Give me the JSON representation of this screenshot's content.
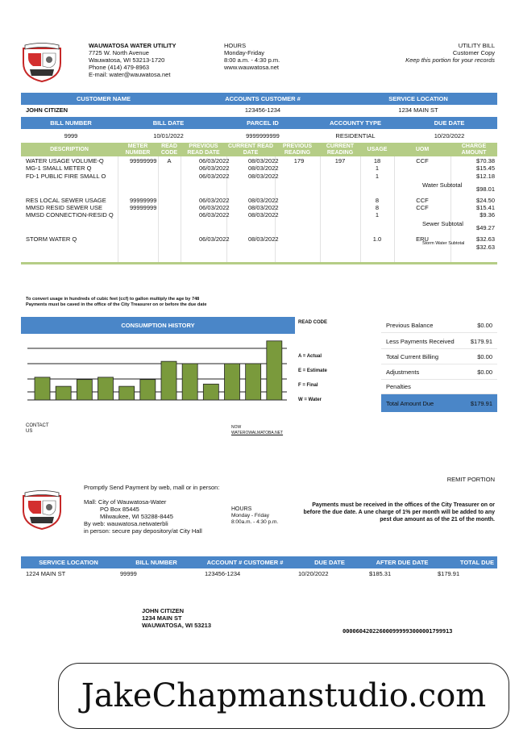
{
  "utility": {
    "name": "WAUWATOSA WATER UTILITY",
    "address1": "7725 W. North Avenue",
    "address2": "Wauwatosa, WI 53213-1720",
    "phone": "Phone (414) 479-8963",
    "email": "E-mail: water@wauwatosa.net",
    "logo_text": "WAUWATOSA",
    "logo_motto": "IN GOD WE TRUST"
  },
  "hours": {
    "label": "HOURS",
    "days": "Monday-Friday",
    "time": "8:00 a.m. - 4:30 p.m.",
    "web": "www.wauwatosa.net"
  },
  "bill_type": {
    "title": "UTILITY BILL",
    "copy": "Customer Copy",
    "keep": "Keep this portion for your records"
  },
  "customer_bar": {
    "h1": "CUSTOMER NAME",
    "h2": "ACCOUNTS CUSTOMER #",
    "h3": "SERVICE LOCATION",
    "name": "JOHN CITIZEN",
    "account": "123456-1234",
    "location": "1234 MAIN ST"
  },
  "bill_bar": {
    "h1": "BILL NUMBER",
    "h2": "BILL DATE",
    "h3": "PARCEL ID",
    "h4": "ACCOUNTY TYPE",
    "h5": "DUE DATE",
    "bill_number": "9999",
    "bill_date": "10/01/2022",
    "parcel_id": "9999999999",
    "account_type": "RESIDENTIAL",
    "due_date": "10/20/2022"
  },
  "charges": {
    "headers": [
      "DESCRIPTION",
      "METER NUMBER",
      "READ CODE",
      "PREVIOUS READ DATE",
      "CURRENT READ DATE",
      "PREVIOUS READING",
      "CURRENT READING",
      "USAGE",
      "UOM",
      "CHARGE AMOUNT"
    ],
    "rows": [
      {
        "desc": "WATER USAGE VOLUME-Q",
        "meter": "99999999",
        "code": "A",
        "prev_date": "06/03/2022",
        "cur_date": "08/03/2022",
        "prev_read": "179",
        "cur_read": "197",
        "usage": "18",
        "uom": "CCF",
        "amount": "$70.38"
      },
      {
        "desc": "MG-1 SMALL METER Q",
        "meter": "",
        "code": "",
        "prev_date": "06/03/2022",
        "cur_date": "08/03/2022",
        "prev_read": "",
        "cur_read": "",
        "usage": "1",
        "uom": "",
        "amount": "$15.45"
      },
      {
        "desc": "FD-1 PUBLIC FIRE SMALL O",
        "meter": "",
        "code": "",
        "prev_date": "06/03/2022",
        "cur_date": "08/03/2022",
        "prev_read": "",
        "cur_read": "",
        "usage": "1",
        "uom": "",
        "amount": "$12.18"
      },
      {
        "desc": "",
        "meter": "",
        "code": "",
        "prev_date": "",
        "cur_date": "",
        "prev_read": "",
        "cur_read": "",
        "usage": "",
        "uom": "Water Subtotal",
        "amount": "$98.01"
      },
      {
        "desc": "RES LOCAL SEWER USAGE",
        "meter": "99999999",
        "code": "",
        "prev_date": "06/03/2022",
        "cur_date": "08/03/2022",
        "prev_read": "",
        "cur_read": "",
        "usage": "8",
        "uom": "CCF",
        "amount": "$24.50"
      },
      {
        "desc": "MMSD RESID SEWER USE",
        "meter": "99999999",
        "code": "",
        "prev_date": "06/03/2022",
        "cur_date": "08/03/2022",
        "prev_read": "",
        "cur_read": "",
        "usage": "8",
        "uom": "CCF",
        "amount": "$15.41"
      },
      {
        "desc": "MMSD CONNECTION-RESID Q",
        "meter": "",
        "code": "",
        "prev_date": "06/03/2022",
        "cur_date": "08/03/2022",
        "prev_read": "",
        "cur_read": "",
        "usage": "1",
        "uom": "",
        "amount": "$9.36"
      },
      {
        "desc": "",
        "meter": "",
        "code": "",
        "prev_date": "",
        "cur_date": "",
        "prev_read": "",
        "cur_read": "",
        "usage": "",
        "uom": "Sewer Subtotal",
        "amount": "$49.27"
      },
      {
        "desc": "STORM WATER Q",
        "meter": "",
        "code": "",
        "prev_date": "06/03/2022",
        "cur_date": "08/03/2022",
        "prev_read": "",
        "cur_read": "",
        "usage": "1.0",
        "uom": "ERU",
        "amount": "$32.63"
      },
      {
        "desc": "",
        "meter": "",
        "code": "",
        "prev_date": "",
        "cur_date": "",
        "prev_read": "",
        "cur_read": "",
        "usage": "",
        "uom": "Storm Water Subtotal",
        "amount": "$32.63"
      }
    ]
  },
  "notes": {
    "line1": "To convert usage in hundreds of cubic feet (ccf) to gallon multiply the age by 748",
    "line2": "Payments must be caved in the office of the City Treasurer on or before the due date"
  },
  "history": {
    "title": "CONSUMPTION HISTORY",
    "read_code_label": "READ CODE",
    "legend": [
      "A = Actual",
      "E = Estimate",
      "F = Final",
      "W = Water"
    ]
  },
  "chart_data": {
    "type": "bar",
    "title": "CONSUMPTION HISTORY",
    "values": [
      10,
      6,
      9,
      10,
      6,
      9,
      17,
      16,
      7,
      16,
      16,
      26
    ],
    "ylim": [
      0,
      27
    ],
    "grid": true
  },
  "summary": [
    {
      "label": "Previous Balance",
      "value": "$0.00"
    },
    {
      "label": "Less Payments Received",
      "value": "$179.91"
    },
    {
      "label": "Total Current Billing",
      "value": "$0.00"
    },
    {
      "label": "Adjustments",
      "value": "$0.00"
    },
    {
      "label": "Penalties",
      "value": ""
    },
    {
      "label": "Total Amount Due",
      "value": "$179.91"
    }
  ],
  "contact": {
    "left1": "CONTACT",
    "left2": "US",
    "right1": "NOW",
    "right2": "WATEROWALMATOBA.NET"
  },
  "remit": {
    "title": "REMIT PORTION",
    "promptly": "Promptly Send Payment by web, mall or in person:",
    "mail1": "Mall: City of Wauwatosa-Water",
    "mail2": "PO Box 85445",
    "mail3": "Milwaukee, WI 53288-8445",
    "web": "By web:  wauwatosa.netwaterbli",
    "person": "in person: secure pay depository/at City Hall",
    "hours_label": "HOURS",
    "hours_days": "Monday - Friday",
    "hours_time": "8:00a.m. - 4:30 p.m.",
    "notice": "Payments must be received in the offices of the City Treasurer on or before the due date. A une charge of 1% per month will be added to any pest due amount as of the 21 of the month.",
    "headers": [
      "SERVICE LOCATION",
      "BILL NUMBER",
      "ACCOUNT # CUSTOMER #",
      "DUE DATE",
      "AFTER DUE DATE",
      "TOTAL DUE"
    ],
    "values": [
      "1224 MAIN ST",
      "99999",
      "123456-1234",
      "10/20/2022",
      "$185.31",
      "$179.91"
    ],
    "addr_name": "JOHN CITIZEN",
    "addr_street": "1234 MAIN ST",
    "addr_city": "WAUWATOSA, WI 53213",
    "barcode": "000060420226000999993000001799913"
  },
  "watermark": "JakeChapmanstudio.com"
}
